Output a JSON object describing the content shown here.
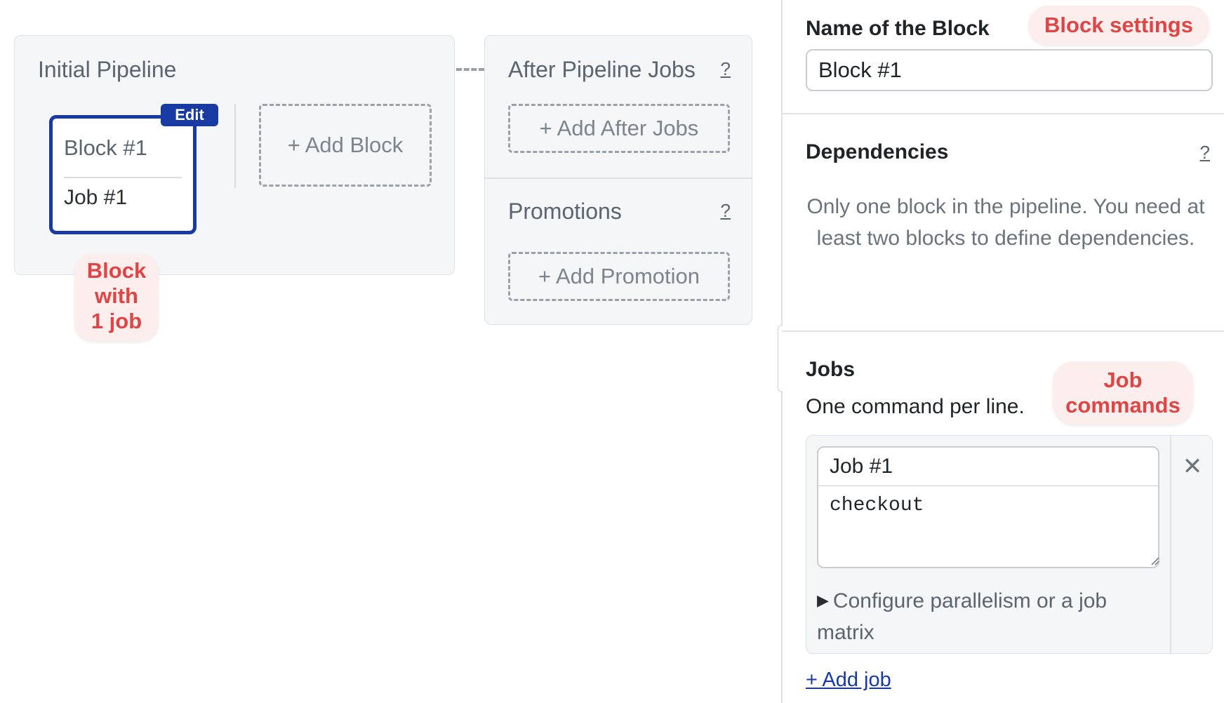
{
  "canvas": {
    "pipeline": {
      "title": "Initial Pipeline",
      "block": {
        "name": "Block #1",
        "job": "Job #1",
        "edit_label": "Edit"
      },
      "add_block_label": "+ Add Block"
    },
    "after_pipeline": {
      "title": "After Pipeline Jobs",
      "help": "?",
      "add_label": "+ Add After Jobs"
    },
    "promotions": {
      "title": "Promotions",
      "help": "?",
      "add_label": "+ Add Promotion"
    },
    "annotation_block": [
      "Block",
      "with",
      "1 job"
    ]
  },
  "panel": {
    "name_label": "Name of the Block",
    "name_value": "Block #1",
    "annotation_settings": "Block settings",
    "dependencies": {
      "label": "Dependencies",
      "help": "?",
      "text": "Only one block in the pipeline. You need at least two blocks to define dependencies."
    },
    "jobs": {
      "label": "Jobs",
      "subtitle": "One command per line.",
      "annotation": [
        "Job",
        "commands"
      ],
      "items": [
        {
          "name": "Job #1",
          "commands": "checkout",
          "close_icon": "close-icon",
          "parallelism_label": "Configure parallelism or a job matrix"
        }
      ],
      "add_job_label": "+ Add job"
    }
  },
  "colors": {
    "accent": "#173aa3",
    "annotation_text": "#e04545",
    "annotation_bg": "#fdeeee",
    "card_bg": "#f5f6f7"
  }
}
